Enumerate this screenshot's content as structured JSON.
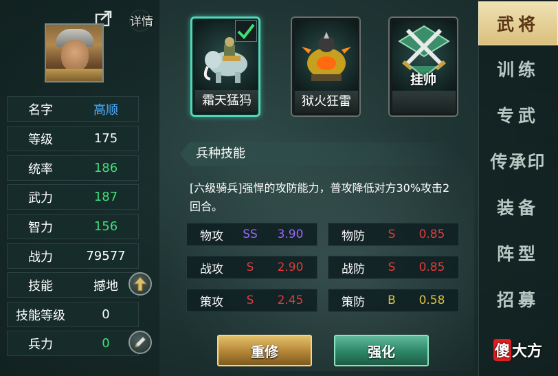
{
  "header": {
    "detail_label": "详情"
  },
  "stats": [
    {
      "label": "名字",
      "value": "高顺"
    },
    {
      "label": "等级",
      "value": "175"
    },
    {
      "label": "统率",
      "value": "186"
    },
    {
      "label": "武力",
      "value": "187"
    },
    {
      "label": "智力",
      "value": "156"
    },
    {
      "label": "战力",
      "value": "79577"
    },
    {
      "label": "技能",
      "value": "撼地"
    },
    {
      "label": "技能等级",
      "value": "0"
    },
    {
      "label": "兵力",
      "value": "0"
    }
  ],
  "units": [
    {
      "label": "霜天猛犸",
      "selected": true
    },
    {
      "label": "狱火狂雷",
      "selected": false
    },
    {
      "label": "",
      "banner": "挂帅",
      "selected": false
    }
  ],
  "skill": {
    "title": "兵种技能",
    "description": "[六级骑兵]强悍的攻防能力，普攻降低对方30%攻击2回合。",
    "attributes": [
      {
        "label": "物攻",
        "grade": "SS",
        "value": "3.90"
      },
      {
        "label": "物防",
        "grade": "S",
        "value": "0.85"
      },
      {
        "label": "战攻",
        "grade": "S",
        "value": "2.90"
      },
      {
        "label": "战防",
        "grade": "S",
        "value": "0.85"
      },
      {
        "label": "策攻",
        "grade": "S",
        "value": "2.45"
      },
      {
        "label": "策防",
        "grade": "B",
        "value": "0.58"
      }
    ]
  },
  "actions": {
    "rebuild": "重修",
    "enhance": "强化"
  },
  "nav": [
    {
      "label": "武将",
      "active": true
    },
    {
      "label": "训练",
      "active": false
    },
    {
      "label": "专武",
      "active": false
    },
    {
      "label": "传承印",
      "active": false
    },
    {
      "label": "装备",
      "active": false
    },
    {
      "label": "阵型",
      "active": false
    },
    {
      "label": "招募",
      "active": false
    }
  ],
  "watermark": {
    "red": "傻",
    "rest": "大方"
  },
  "colors": {
    "accent_teal": "#4fd8b8",
    "nav_active_bg": "#f0e2b4",
    "grade_ss": "#9a66ff",
    "grade_s": "#e23b3b",
    "grade_b": "#d8c040",
    "stat_green": "#3fe07a",
    "name_blue": "#4fb0ff"
  },
  "icons": [
    "share-icon",
    "up-arrow-icon",
    "pencil-icon",
    "check-icon",
    "mammoth-icon",
    "beast-icon",
    "crossed-swords-icon"
  ]
}
